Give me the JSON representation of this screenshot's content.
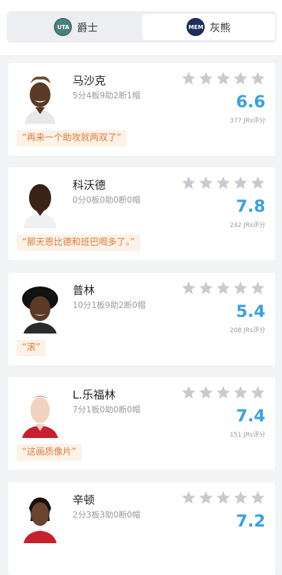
{
  "tabs": [
    {
      "label": "爵士",
      "logo_text": "UTA",
      "logo_icon": "jazz-team-logo-icon"
    },
    {
      "label": "灰熊",
      "logo_text": "MEM",
      "logo_icon": "grizzlies-team-logo-icon",
      "selected": true
    }
  ],
  "colors": {
    "accent": "#3aa1e3",
    "quote_text": "#e07a3a",
    "quote_bg": "#fdf2e7",
    "star": "#c7cbd1"
  },
  "players": [
    {
      "name": "马沙克",
      "stats": "5分4板9助2断1帽",
      "score": "6.6",
      "votes": "377 JRs评分",
      "quote": "“再来一个助攻就两双了”",
      "rating_stars": 0
    },
    {
      "name": "科沃德",
      "stats": "0分0板0助0断0帽",
      "score": "7.8",
      "votes": "242 JRs评分",
      "quote": "“那天恩比德和班巴喝多了。”",
      "rating_stars": 0
    },
    {
      "name": "普林",
      "stats": "10分1板9助2断0帽",
      "score": "5.4",
      "votes": "208 JRs评分",
      "quote": "“滚”",
      "rating_stars": 0
    },
    {
      "name": "L.乐福林",
      "stats": "7分1板0助0断0帽",
      "score": "7.4",
      "votes": "151 JRs评分",
      "quote": "“这画质像片”",
      "rating_stars": 0
    },
    {
      "name": "辛顿",
      "stats": "2分3板3助0断0帽",
      "score": "7.2",
      "votes": "",
      "quote": "",
      "rating_stars": 0
    }
  ]
}
